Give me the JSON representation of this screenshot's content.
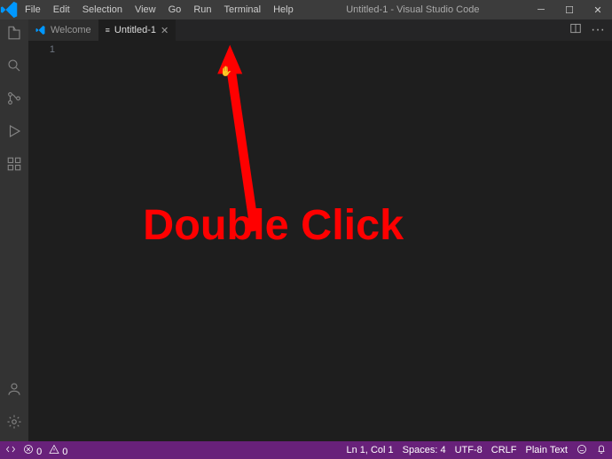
{
  "titlebar": {
    "menus": [
      "File",
      "Edit",
      "Selection",
      "View",
      "Go",
      "Run",
      "Terminal",
      "Help"
    ],
    "title": "Untitled-1 - Visual Studio Code"
  },
  "tabs": {
    "welcome": "Welcome",
    "active": "Untitled-1"
  },
  "gutter": {
    "line1": "1"
  },
  "annotation": {
    "text": "Double Click"
  },
  "statusbar": {
    "errors": "0",
    "warnings": "0",
    "lncol": "Ln 1, Col 1",
    "spaces": "Spaces: 4",
    "encoding": "UTF-8",
    "eol": "CRLF",
    "language": "Plain Text"
  }
}
